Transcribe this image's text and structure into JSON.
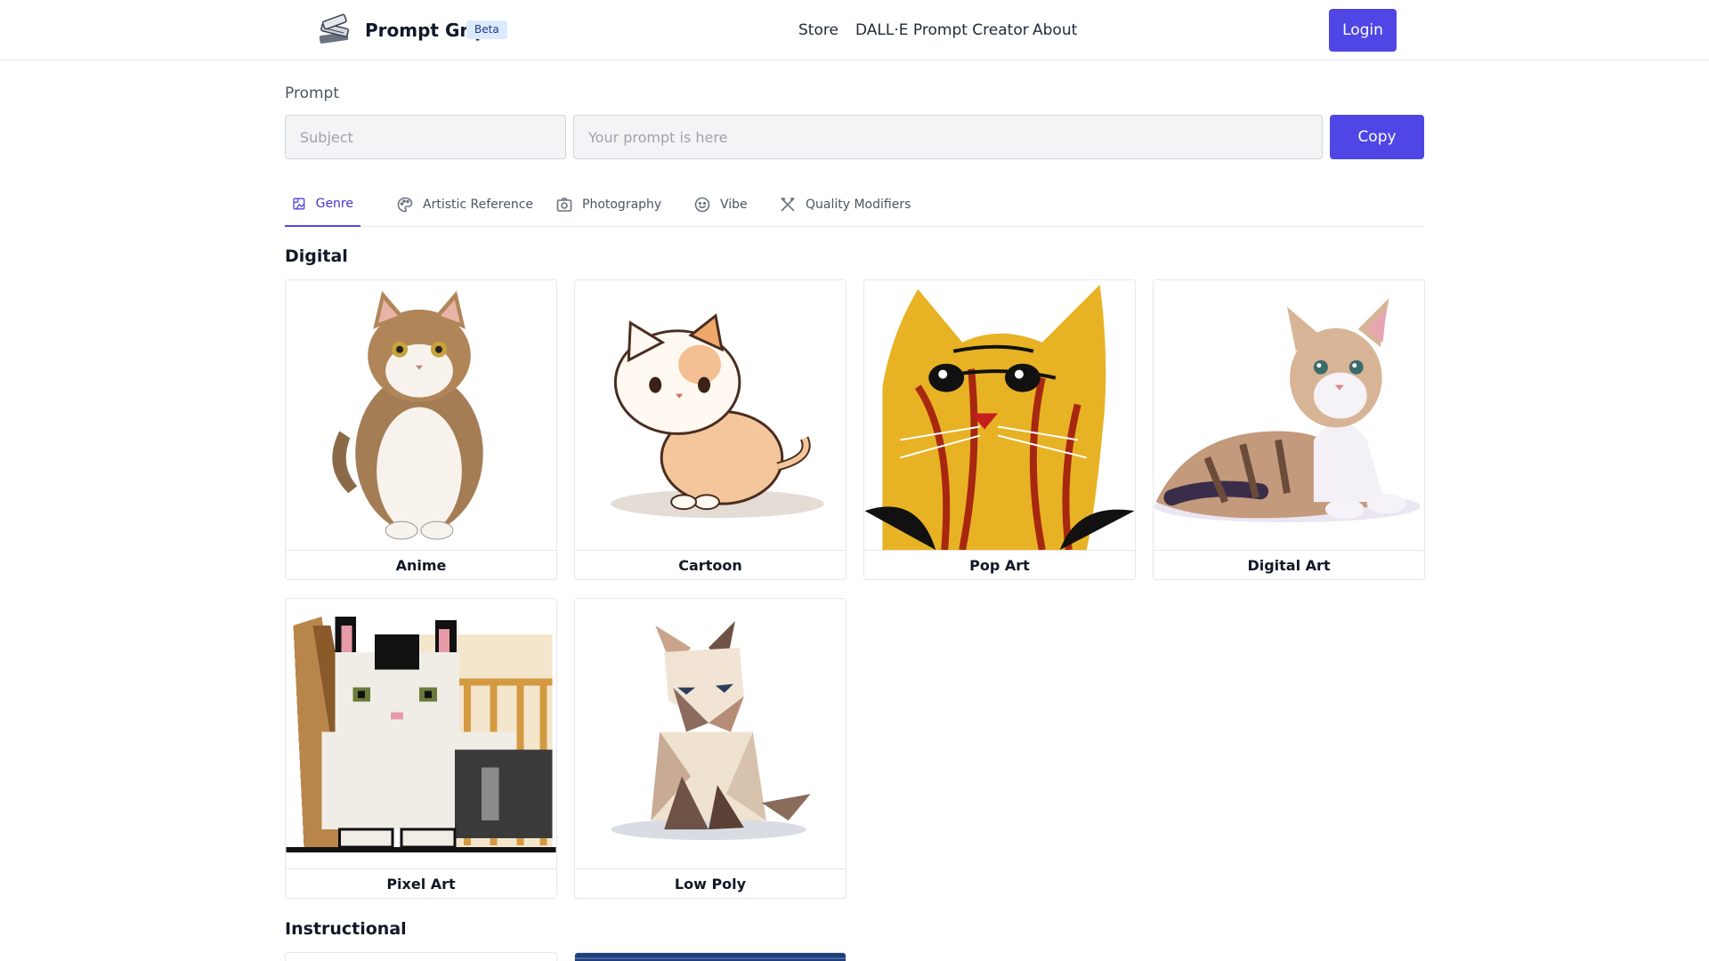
{
  "header": {
    "brand": "Prompt Grip",
    "badge": "Beta",
    "nav": [
      "Store",
      "DALL·E Prompt Creator",
      "About"
    ],
    "login_label": "Login"
  },
  "prompt": {
    "label": "Prompt",
    "subject_placeholder": "Subject",
    "prompt_placeholder": "Your prompt is here",
    "copy_label": "Copy"
  },
  "tabs": [
    {
      "label": "Genre",
      "icon": "genre-icon",
      "active": true
    },
    {
      "label": "Artistic Reference",
      "icon": "palette-icon",
      "active": false
    },
    {
      "label": "Photography",
      "icon": "camera-icon",
      "active": false
    },
    {
      "label": "Vibe",
      "icon": "smile-icon",
      "active": false
    },
    {
      "label": "Quality Modifiers",
      "icon": "tools-icon",
      "active": false
    }
  ],
  "sections": [
    {
      "title": "Digital",
      "cards": [
        {
          "label": "Anime"
        },
        {
          "label": "Cartoon"
        },
        {
          "label": "Pop Art"
        },
        {
          "label": "Digital Art"
        },
        {
          "label": "Pixel Art"
        },
        {
          "label": "Low Poly"
        }
      ]
    },
    {
      "title": "Instructional",
      "cards": []
    }
  ],
  "colors": {
    "accent": "#4f46e5",
    "badge_bg": "#dbeafe",
    "border": "#e5e7eb"
  }
}
